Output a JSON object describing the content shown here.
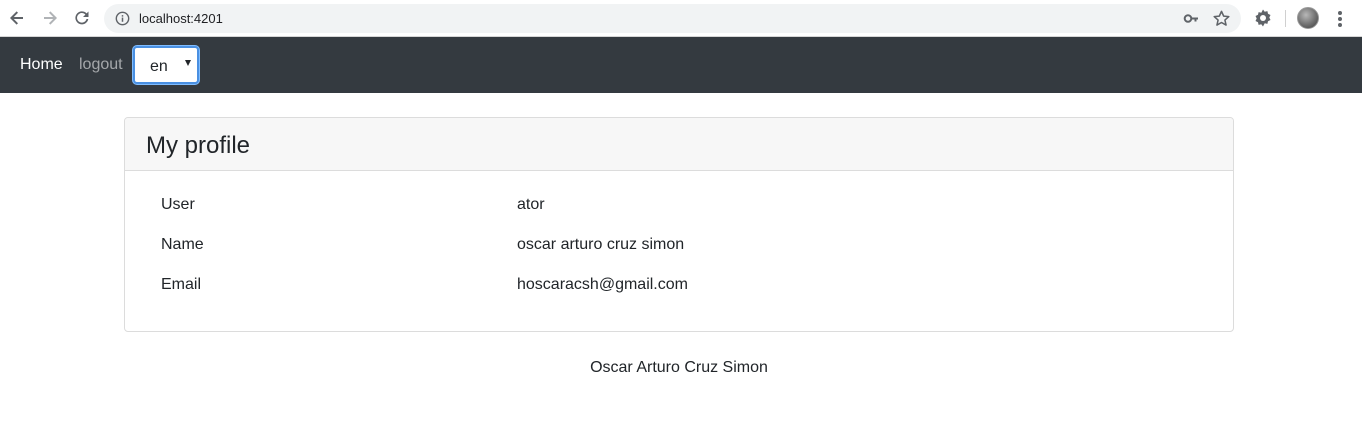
{
  "browser": {
    "url": "localhost:4201"
  },
  "navbar": {
    "home_label": "Home",
    "logout_label": "logout",
    "language": {
      "selected": "en"
    }
  },
  "profile": {
    "title": "My profile",
    "rows": [
      {
        "label": "User",
        "value": "ator"
      },
      {
        "label": "Name",
        "value": "oscar arturo cruz simon"
      },
      {
        "label": "Email",
        "value": "hoscaracsh@gmail.com"
      }
    ]
  },
  "footer": {
    "text": "Oscar Arturo Cruz Simon"
  },
  "icons": {
    "back": "arrow-left-icon",
    "forward": "arrow-right-icon",
    "reload": "reload-icon",
    "info": "info-icon",
    "key": "key-icon",
    "star": "star-icon",
    "extension": "gear-icon",
    "avatar": "avatar",
    "menu": "more-vert-icon"
  },
  "colors": {
    "navbar_bg": "#343a40",
    "select_focus": "#80bdff",
    "card_header_bg": "#f7f7f7"
  }
}
